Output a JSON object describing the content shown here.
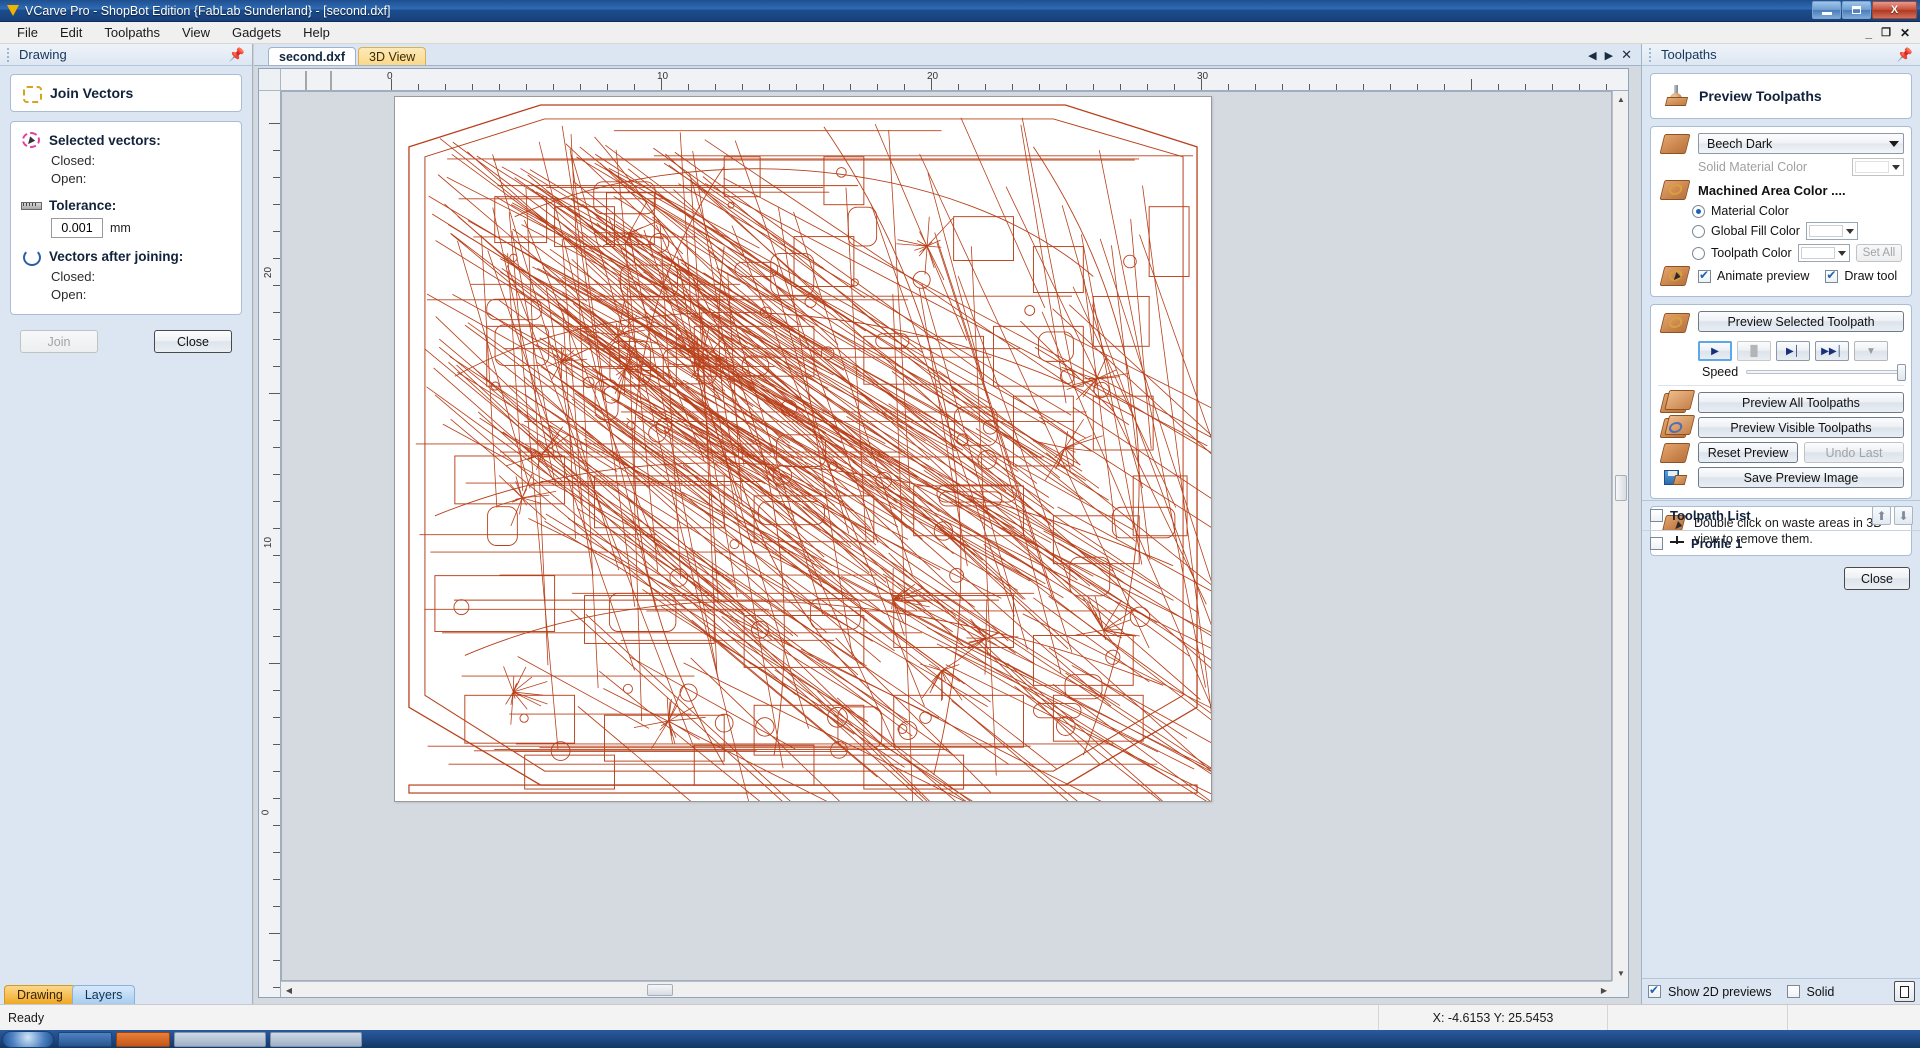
{
  "window": {
    "title": "VCarve Pro - ShopBot Edition {FabLab Sunderland} - [second.dxf]",
    "app_icon": "vcarve-logo-icon",
    "minimize_label": "–",
    "maximize_label": "❐",
    "close_label": "X",
    "mdi_minimize": "_",
    "mdi_restore": "❐",
    "mdi_close": "✕"
  },
  "menu": {
    "items": [
      "File",
      "Edit",
      "Toolpaths",
      "View",
      "Gadgets",
      "Help"
    ]
  },
  "left_panel": {
    "header_title": "Drawing",
    "pin_icon": "pin-icon",
    "form_title": "Join Vectors",
    "form_title_icon": "join-vectors-icon",
    "selected_vectors": {
      "icon": "selected-vectors-icon",
      "heading": "Selected vectors:",
      "closed_label": "Closed:",
      "closed_value": "",
      "open_label": "Open:",
      "open_value": ""
    },
    "tolerance": {
      "icon": "ruler-icon",
      "heading": "Tolerance:",
      "value": "0.001",
      "unit": "mm"
    },
    "after_joining": {
      "icon": "vectors-after-joining-icon",
      "heading": "Vectors after joining:",
      "closed_label": "Closed:",
      "closed_value": "",
      "open_label": "Open:",
      "open_value": ""
    },
    "join_button": "Join",
    "join_button_enabled": false,
    "close_button": "Close",
    "tabs": [
      {
        "label": "Drawing",
        "active": true
      },
      {
        "label": "Layers",
        "active": false
      }
    ]
  },
  "center": {
    "tabs": [
      {
        "label": "second.dxf",
        "active": true,
        "style": "document"
      },
      {
        "label": "3D View",
        "active": false,
        "style": "view3d"
      }
    ],
    "tab_controls": {
      "prev_icon": "chevron-left-icon",
      "next_icon": "chevron-right-icon",
      "close_icon": "close-icon"
    },
    "ruler": {
      "horizontal_labels": [
        "0",
        "10",
        "20",
        "30"
      ],
      "vertical_labels": [
        "20",
        "10",
        "0"
      ],
      "unit": "mm"
    },
    "drawing_color": "#b8401a",
    "sheet_background": "#ffffff"
  },
  "right_panel": {
    "header_title": "Toolpaths",
    "pin_icon": "pin-icon",
    "form_title": "Preview Toolpaths",
    "form_title_icon": "preview-toolpaths-icon",
    "material": {
      "icon": "material-icon",
      "selected": "Beech Dark",
      "solid_material_color_label": "Solid Material Color",
      "solid_material_color_enabled": false
    },
    "machined_area": {
      "icon": "machined-area-icon",
      "heading": "Machined Area Color ....",
      "options": [
        {
          "label": "Material Color",
          "selected": true,
          "has_color_picker": false
        },
        {
          "label": "Global Fill Color",
          "selected": false,
          "has_color_picker": true
        },
        {
          "label": "Toolpath Color",
          "selected": false,
          "has_color_picker": true
        }
      ],
      "set_all_button": "Set All",
      "set_all_enabled": false
    },
    "animate": {
      "icon": "animate-icon",
      "animate_preview_label": "Animate preview",
      "animate_preview_checked": true,
      "draw_tool_label": "Draw tool",
      "draw_tool_checked": true
    },
    "preview_selected": {
      "icon": "preview-selected-icon",
      "button": "Preview Selected Toolpath",
      "transport": [
        {
          "name": "play",
          "glyph": "▶",
          "state": "focused"
        },
        {
          "name": "pause",
          "glyph": "▐▌",
          "state": "disabled"
        },
        {
          "name": "step",
          "glyph": "▶│",
          "state": "enabled"
        },
        {
          "name": "fast-forward",
          "glyph": "▶▶│",
          "state": "enabled"
        },
        {
          "name": "to-end",
          "glyph": "▼",
          "state": "disabled"
        }
      ],
      "speed_label": "Speed",
      "speed_value": 100
    },
    "actions": [
      {
        "label": "Preview All Toolpaths",
        "icon": "preview-all-icon",
        "enabled": true
      },
      {
        "label": "Preview Visible Toolpaths",
        "icon": "preview-visible-icon",
        "enabled": true
      }
    ],
    "reset_preview_button": "Reset Preview",
    "undo_last_button": "Undo Last",
    "undo_last_enabled": false,
    "reset_icon": "reset-preview-icon",
    "save_preview_button": "Save Preview Image",
    "save_icon": "save-preview-icon",
    "hint": {
      "icon": "double-click-hint-icon",
      "text": "Double click on waste areas in 3D view to remove them."
    },
    "close_button": "Close",
    "toolpath_list": {
      "title": "Toolpath List",
      "title_checked": false,
      "move_up_icon": "arrow-up-icon",
      "move_down_icon": "arrow-down-icon",
      "items": [
        {
          "name": "Profile 1",
          "checked": false,
          "icon": "profile-toolpath-icon"
        }
      ]
    },
    "footer": {
      "show_2d_previews_label": "Show 2D previews",
      "show_2d_previews_checked": true,
      "solid_label": "Solid",
      "solid_checked": false,
      "list_view_icon": "list-view-icon"
    }
  },
  "status_bar": {
    "ready_text": "Ready",
    "coordinates": "X: -4.6153 Y: 25.5453"
  }
}
